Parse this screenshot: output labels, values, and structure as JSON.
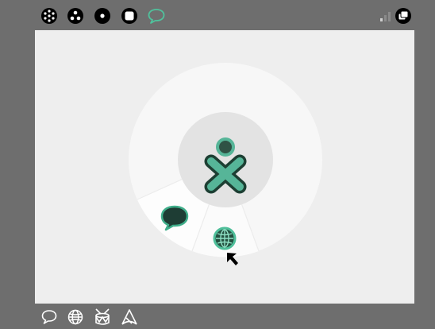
{
  "window": {
    "title": ""
  },
  "topbar": {
    "views": [
      {
        "name": "neighborhood-view-icon",
        "active": false
      },
      {
        "name": "group-view-icon",
        "active": false
      },
      {
        "name": "home-view-icon",
        "active": false
      },
      {
        "name": "activity-view-icon",
        "active": false
      },
      {
        "name": "chat-activity-icon",
        "active": true
      }
    ],
    "right": [
      {
        "name": "wireless-signal-icon"
      },
      {
        "name": "window-switch-icon"
      }
    ]
  },
  "home": {
    "ring_activities": [
      {
        "name": "chat-activity-icon",
        "highlighted": true
      },
      {
        "name": "browse-activity-icon",
        "highlighted": true,
        "hovered": true
      }
    ],
    "center": {
      "name": "xo-buddy-icon"
    }
  },
  "bottombar": {
    "activities": [
      {
        "name": "chat-launcher-icon"
      },
      {
        "name": "browse-launcher-icon"
      },
      {
        "name": "tamtam-launcher-icon"
      },
      {
        "name": "write-launcher-icon"
      }
    ]
  },
  "colors": {
    "frame": "#6e6e6e",
    "desktop": "#eeeeee",
    "ring": "#f7f7f7",
    "ring_highlight": "#fdfdfd",
    "center": "#e3e3e3",
    "xo_fill": "#56b598",
    "xo_stroke": "#1d3f33",
    "chat_top": "#44d6a8"
  }
}
